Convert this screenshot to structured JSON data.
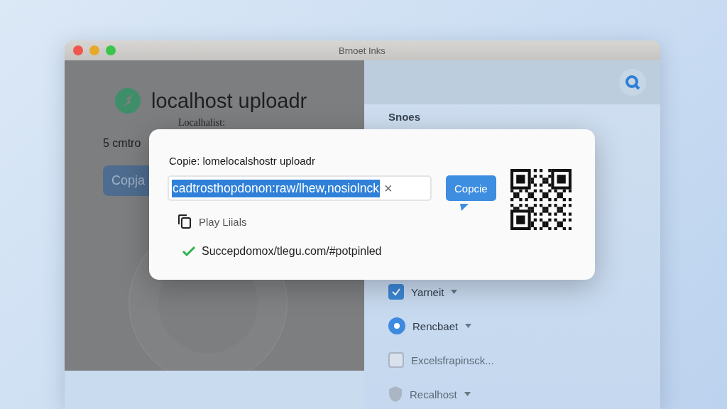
{
  "window": {
    "title": "Brnoet Inks"
  },
  "app": {
    "name": "localhost uploadr",
    "subtitle": "Localhalist:",
    "count": "5 cmtro",
    "button": "Copja"
  },
  "side_panel": {
    "heading": "Snoes",
    "items": [
      {
        "label": "Yarneit",
        "kind": "checkbox",
        "dropdown": true
      },
      {
        "label": "Rencbaet",
        "kind": "radio",
        "dropdown": true
      },
      {
        "label": "Excelsfrapinsck...",
        "kind": "square",
        "dropdown": false
      },
      {
        "label": "Recalhost",
        "kind": "shield",
        "dropdown": true
      }
    ]
  },
  "dialog": {
    "title": "Copie: lomelocalshostr uploadr",
    "link_field": {
      "value": "cadtrosthopdonon:raw/lhew,nosiolnck",
      "selected": true
    },
    "clear": "×",
    "copy_button": "Copcie",
    "option": "Play Liials",
    "status": {
      "kind": "success",
      "text": "Succepdomox/tlegu.com/#potpinled"
    }
  }
}
